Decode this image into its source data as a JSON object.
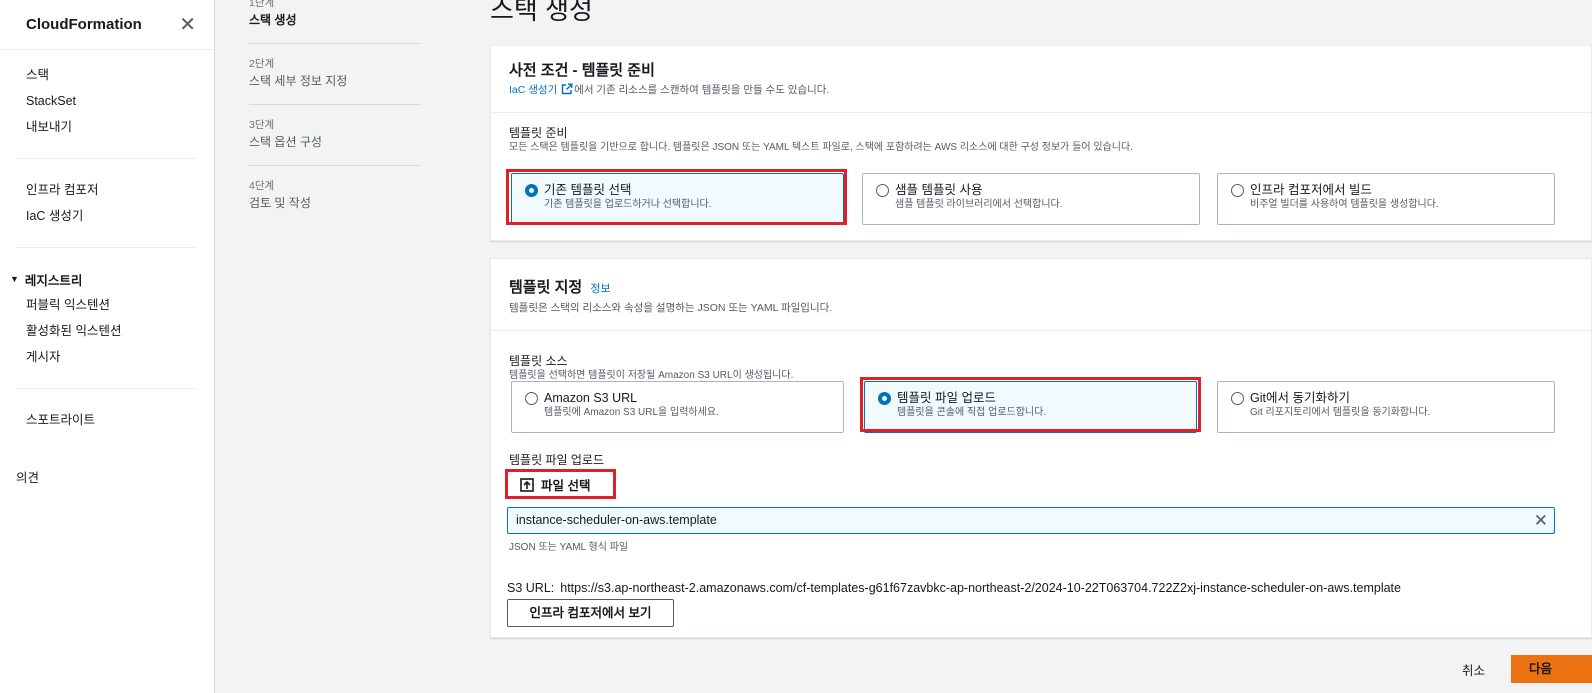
{
  "sidebar": {
    "title": "CloudFormation",
    "close_icon": "close-icon",
    "group1": [
      "스택",
      "StackSet",
      "내보내기"
    ],
    "group2": [
      "인프라 컴포저",
      "IaC 생성기"
    ],
    "registry": {
      "label": "레지스트리",
      "items": [
        "퍼블릭 익스텐션",
        "활성화된 익스텐션",
        "게시자"
      ]
    },
    "group4": [
      "스포트라이트"
    ],
    "feedback": "의견"
  },
  "steps": [
    {
      "num": "1단계",
      "label": "스택 생성"
    },
    {
      "num": "2단계",
      "label": "스택 세부 정보 지정"
    },
    {
      "num": "3단계",
      "label": "스택 옵션 구성"
    },
    {
      "num": "4단계",
      "label": "검토 및 작성"
    }
  ],
  "page_title": "스택 생성",
  "prereq": {
    "title": "사전 조건 - 템플릿 준비",
    "desc_link": "IaC 생성기",
    "desc_rest": "에서 기존 리소스를 스캔하여 템플릿을 만들 수도 있습니다.",
    "field_label": "템플릿 준비",
    "field_desc": "모든 스택은 템플릿을 기반으로 합니다. 템플릿은 JSON 또는 YAML 텍스트 파일로, 스택에 포함하려는 AWS 리소스에 대한 구성 정보가 들어 있습니다.",
    "options": [
      {
        "title": "기존 템플릿 선택",
        "desc": "기존 템플릿을 업로드하거나 선택합니다.",
        "selected": true
      },
      {
        "title": "샘플 템플릿 사용",
        "desc": "샘플 템플릿 라이브러리에서 선택합니다.",
        "selected": false
      },
      {
        "title": "인프라 컴포저에서 빌드",
        "desc": "비주얼 빌더를 사용하여 템플릿을 생성합니다.",
        "selected": false
      }
    ]
  },
  "spec": {
    "title": "템플릿 지정",
    "info": "정보",
    "desc": "템플릿은 스택의 리소스와 속성을 설명하는 JSON 또는 YAML 파일입니다.",
    "source_label": "템플릿 소스",
    "source_desc": "템플릿을 선택하면 템플릿이 저장될 Amazon S3 URL이 생성됩니다.",
    "options": [
      {
        "title": "Amazon S3 URL",
        "desc": "템플릿에 Amazon S3 URL을 입력하세요.",
        "selected": false
      },
      {
        "title": "템플릿 파일 업로드",
        "desc": "템플릿을 콘솔에 직접 업로드합니다.",
        "selected": true
      },
      {
        "title": "Git에서 동기화하기",
        "desc": "Git 리포지토리에서 템플릿을 동기화합니다.",
        "selected": false
      }
    ],
    "upload_label": "템플릿 파일 업로드",
    "file_button": "파일 선택",
    "file_name": "instance-scheduler-on-aws.template",
    "file_hint": "JSON 또는 YAML 형식 파일",
    "s3_key": "S3 URL:",
    "s3_value": "https://s3.ap-northeast-2.amazonaws.com/cf-templates-g61f67zavbkc-ap-northeast-2/2024-10-22T063704.722Z2xj-instance-scheduler-on-aws.template",
    "view_button": "인프라 컴포저에서 보기"
  },
  "footer": {
    "cancel": "취소",
    "next": "다음"
  },
  "colors": {
    "accent": "#0073bb",
    "highlight": "#e01f27",
    "primary_button": "#ec7211"
  }
}
